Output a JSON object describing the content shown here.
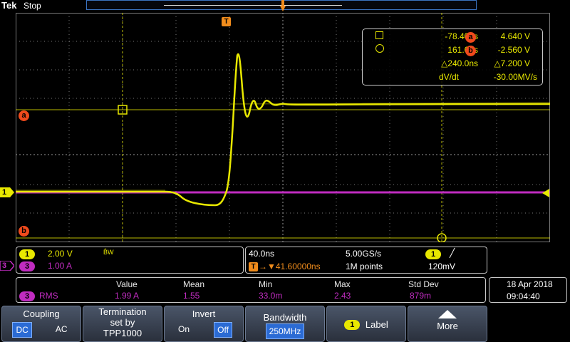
{
  "header": {
    "brand": "Tek",
    "status": "Stop"
  },
  "trigger_marker": "T",
  "cursor_readout": {
    "row1": {
      "time": "-78.40ns",
      "cursor": "a",
      "volts": "4.640 V"
    },
    "row2": {
      "time": "161.6ns",
      "cursor": "b",
      "volts": "-2.560 V"
    },
    "row3": {
      "delta_time": "△240.0ns",
      "delta_volts": "△7.200 V"
    },
    "row4": {
      "label": "dV/dt",
      "value": "-30.00MV/s"
    }
  },
  "cursor_labels": {
    "a": "a",
    "b": "b"
  },
  "channel_markers": {
    "ch1": "1",
    "ch3": "3"
  },
  "vertical_panel": {
    "ch1": {
      "badge": "1",
      "scale": "2.00 V",
      "bw": "B̂W"
    },
    "ch3": {
      "badge": "3",
      "scale": "1.00 A"
    }
  },
  "horizontal_panel": {
    "time_div": "40.0ns",
    "sample_rate": "5.00GS/s",
    "trig_badge": "1",
    "slope": "╱",
    "delay_icon": "T",
    "delay": "→▼41.60000ns",
    "record": "1M points",
    "trig_level": "120mV"
  },
  "measurement": {
    "headers": [
      "Value",
      "Mean",
      "Min",
      "Max",
      "Std Dev"
    ],
    "source_badge": "3",
    "name": "RMS",
    "values": [
      "1.99 A",
      "1.55",
      "33.0m",
      "2.43",
      "879m"
    ]
  },
  "datetime": {
    "date": "18 Apr 2018",
    "time": "09:04:40"
  },
  "soft_buttons": {
    "coupling": {
      "label": "Coupling",
      "opt1": "DC",
      "opt2": "AC"
    },
    "termination": {
      "line1": "Termination",
      "line2": "set by",
      "line3": "TPP1000"
    },
    "invert": {
      "label": "Invert",
      "opt1": "On",
      "opt2": "Off"
    },
    "bandwidth": {
      "label": "Bandwidth",
      "value": "250MHz"
    },
    "label_btn": {
      "badge": "1",
      "label": "Label"
    },
    "more": {
      "label": "More"
    }
  },
  "colors": {
    "ch1": "#e8e800",
    "ch3": "#c02cc0",
    "cursor": "#f04a1c",
    "trigger": "#f08c1c"
  }
}
